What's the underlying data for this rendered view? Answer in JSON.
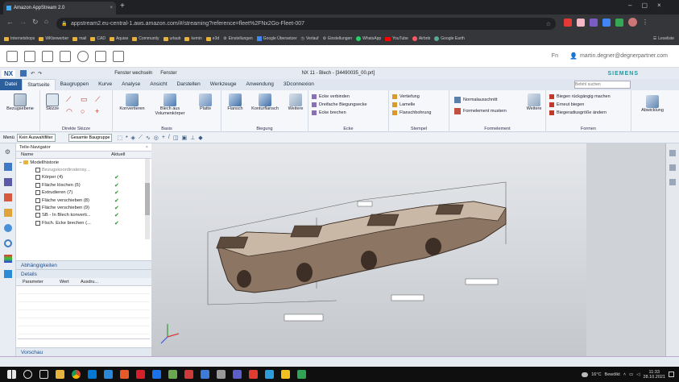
{
  "browser": {
    "tab_title": "Amazon AppStream 2.0",
    "url": "appstream2.eu-central-1.aws.amazon.com/#/streaming?reference=fleet%2FNx2Go-Fleet-007",
    "bookmarks": [
      "Internetshops",
      "WKbewerber",
      "mail",
      "CAD",
      "Aquise",
      "Community",
      "urlaub",
      "kemin",
      "e3d",
      "Einstellungen",
      "Google Übersetzer",
      "Verlauf",
      "Einstellungen",
      "WhatsApp",
      "YouTube",
      "Airbnb",
      "Google Earth"
    ],
    "reading_list": "Leseliste"
  },
  "appstream": {
    "language": "Fn",
    "user": "martin.degner@degnerpartner.com"
  },
  "nx": {
    "logo": "NX",
    "window_switch": "Fenster wechseln",
    "window_menu": "Fenster",
    "title": "NX 11 - Blech - [34490035_00.prt]",
    "brand": "SIEMENS",
    "menu_tabs": [
      "Datei",
      "Startseite",
      "Baugruppen",
      "Kurve",
      "Analyse",
      "Ansicht",
      "Darstellen",
      "Werkzeuge",
      "Anwendung",
      "3Dconnexion"
    ],
    "search_placeholder": "Befehl suchen",
    "ribbon": {
      "bezugsebene": "Bezugsebene",
      "skizze": "Skizze",
      "direkte_skizze": "Direkte Skizze",
      "konvertieren": "Konvertieren",
      "blech_aus": "Blech aus Volumenkörper",
      "platte": "Platte",
      "basis": "Basis",
      "flansch": "Flansch",
      "konturflansch": "Konturflansch",
      "weitere": "Weitere",
      "biegung": "Biegung",
      "ecke_items": [
        "Ecke verbinden",
        "Dreifache Biegungsecke",
        "Ecke brechen"
      ],
      "ecke": "Ecke",
      "stempel_items": [
        "Vertiefung",
        "Lamelle",
        "Flanschbohrung"
      ],
      "stempel": "Stempel",
      "normalausschnitt": "Normalausschnitt",
      "formelement_muster": "Formelement mustern",
      "formelement": "Formelement",
      "weitere2": "Weitere",
      "formen_items": [
        "Biegen rückgängig machen",
        "Erneut biegen",
        "Biegeradiusgröße ändern"
      ],
      "formen": "Formen",
      "abwicklung": "Abwicklung"
    },
    "toolbar2": {
      "menu": "Menü",
      "filter": "Kein Auswahlfilter",
      "scope": "Gesamte Baugruppe"
    },
    "navigator": {
      "title": "Teile-Navigator",
      "col_name": "Name",
      "col_actual": "Aktuell",
      "root": "Modellhistorie",
      "items": [
        "Bezugskoordinatensy...",
        "Körper (4)",
        "Fläche löschen (5)",
        "Extrudieren (7)",
        "Fläche verschieben (8)",
        "Fläche verschieben (9)",
        "SB - In Blech konverti...",
        "Flsch. Ecke brechen (..."
      ]
    },
    "dependencies": "Abhängigkeiten",
    "details": "Details",
    "details_cols": [
      "Parameter",
      "Wert",
      "Ausdru..."
    ],
    "preview": "Vorschau"
  },
  "taskbar": {
    "temp": "16°C",
    "weather": "Bewölkt",
    "time": "11:33",
    "date": "28.10.2021"
  }
}
